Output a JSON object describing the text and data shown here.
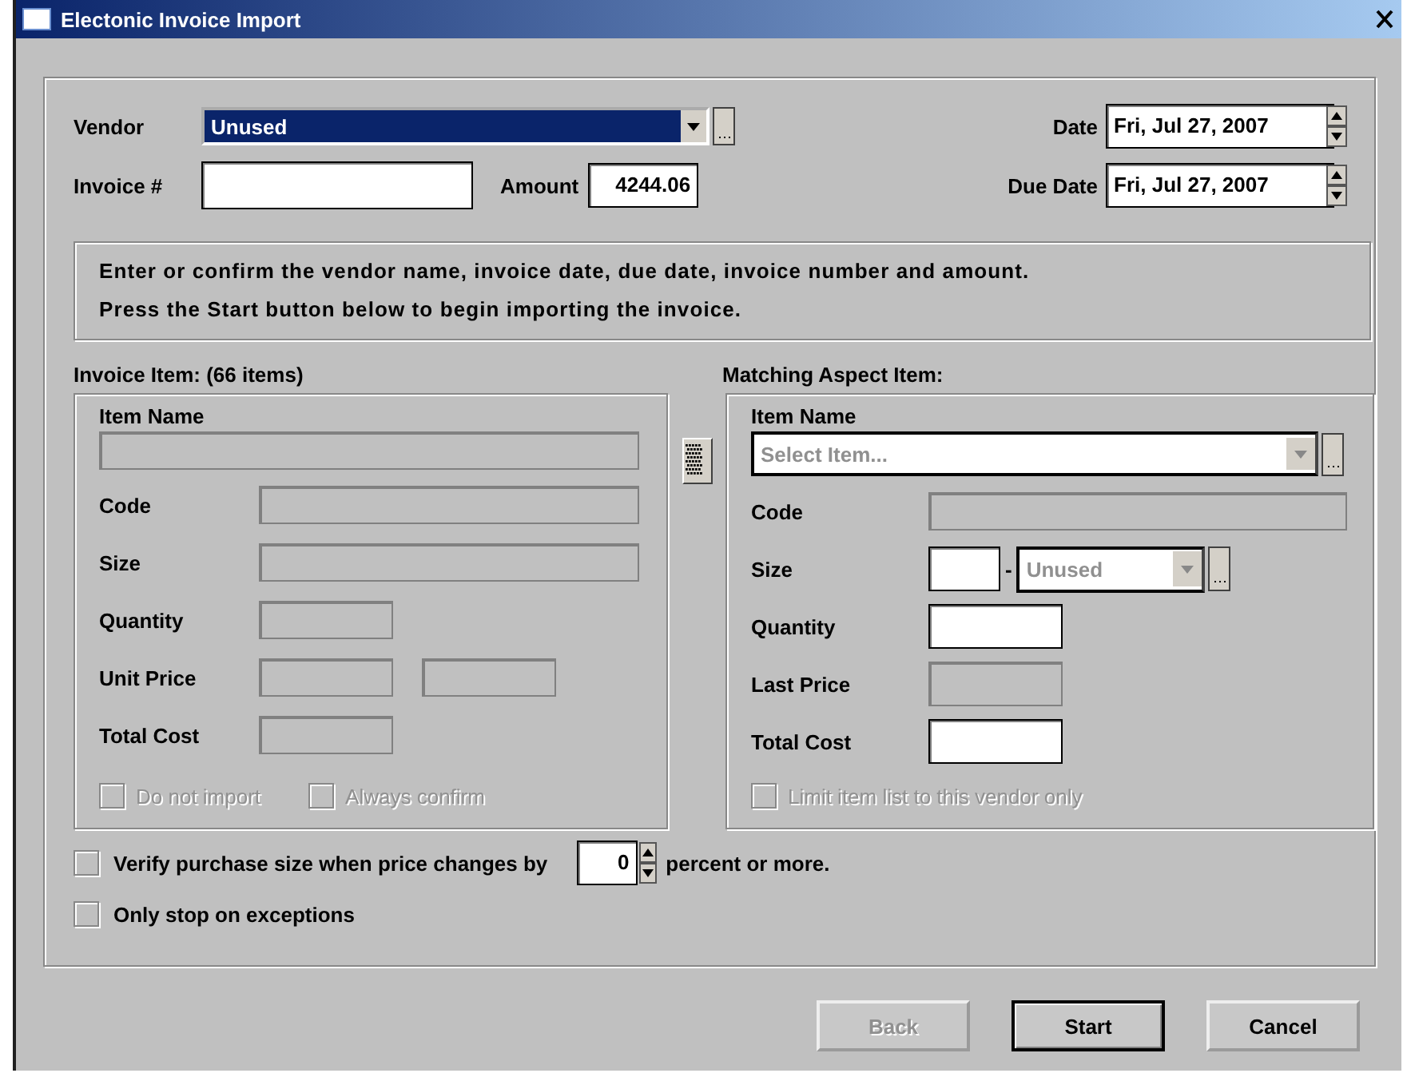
{
  "window": {
    "title": "Electonic Invoice Import"
  },
  "header": {
    "vendor": {
      "label": "Vendor",
      "value": "Unused"
    },
    "invoice_number": {
      "label": "Invoice #"
    },
    "amount": {
      "label": "Amount",
      "value": "4244.06"
    },
    "date": {
      "label": "Date",
      "value": "Fri, Jul 27, 2007"
    },
    "due_date": {
      "label": "Due Date",
      "value": "Fri, Jul 27, 2007"
    }
  },
  "message": [
    "Enter or confirm the vendor name, invoice date, due date, invoice number and amount.",
    "Press the Start button below to begin importing the invoice."
  ],
  "invoice_item": {
    "title": "Invoice Item: (66 items)",
    "fields": [
      {
        "kind": "stacked",
        "label": "Item Name",
        "disabled": true
      },
      {
        "kind": "wide",
        "label": "Code",
        "disabled": true
      },
      {
        "kind": "wide",
        "label": "Size",
        "disabled": true
      },
      {
        "kind": "small",
        "label": "Quantity",
        "disabled": true
      },
      {
        "kind": "double",
        "label": "Unit Price",
        "disabled": true
      },
      {
        "kind": "small",
        "label": "Total Cost",
        "disabled": true
      }
    ],
    "checkboxes": [
      {
        "label": "Do not import",
        "checked": false,
        "disabled": true
      },
      {
        "label": "Always confirm",
        "checked": false,
        "disabled": true
      }
    ]
  },
  "matching_item": {
    "title": "Matching Aspect Item:",
    "fields": [
      {
        "kind": "combo",
        "label": "Item Name",
        "placeholder": "Select Item..."
      },
      {
        "kind": "wide",
        "label": "Code",
        "disabled": true
      },
      {
        "kind": "size",
        "label": "Size",
        "separator": "-",
        "value": "Unused"
      },
      {
        "kind": "small",
        "label": "Quantity",
        "disabled": false
      },
      {
        "kind": "small",
        "label": "Last Price",
        "disabled": true
      },
      {
        "kind": "small",
        "label": "Total Cost",
        "disabled": false
      }
    ],
    "checkboxes": [
      {
        "label": "Limit item list to this vendor only",
        "checked": false,
        "disabled": true
      }
    ]
  },
  "options": [
    {
      "kind": "spinner",
      "label": "Verify purchase size when price changes by",
      "value": "0",
      "suffix": "percent or more.",
      "checked": false
    },
    {
      "kind": "plain",
      "label": "Only stop on exceptions",
      "checked": false
    }
  ],
  "buttons": [
    {
      "label": "Back",
      "disabled": true,
      "default": false
    },
    {
      "label": "Start",
      "disabled": false,
      "default": true
    },
    {
      "label": "Cancel",
      "disabled": false,
      "default": false
    }
  ]
}
